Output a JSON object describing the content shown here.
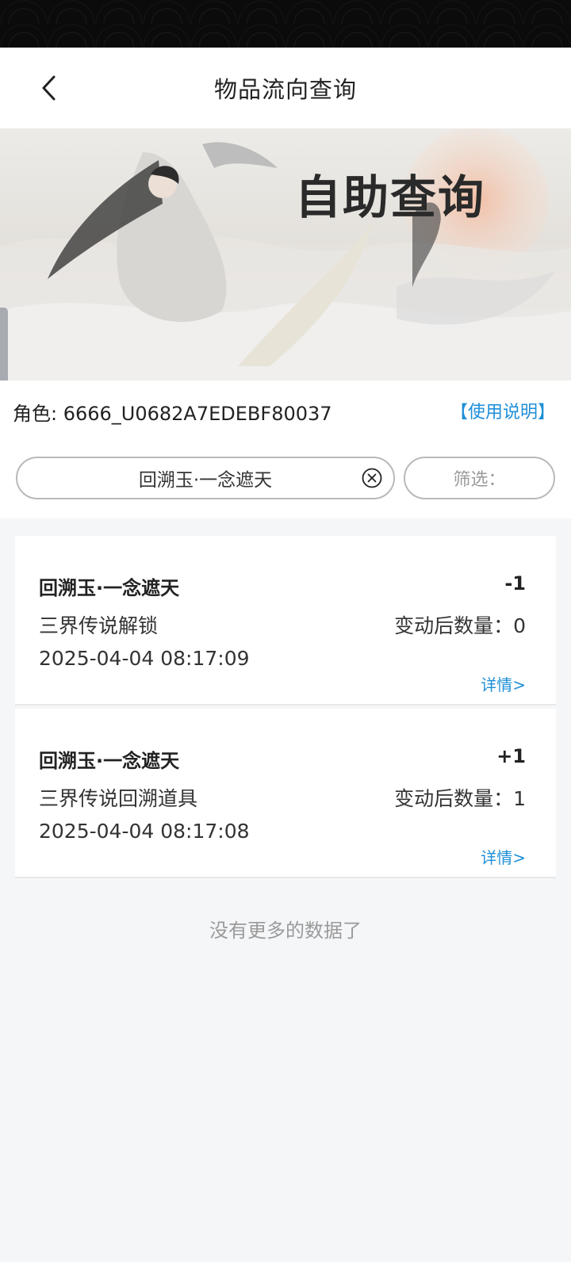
{
  "header": {
    "title": "物品流向查询"
  },
  "banner": {
    "title": "自助查询"
  },
  "info": {
    "role_text": "角色: 6666_U0682A7EDEBF80037",
    "help_link": "【使用说明】"
  },
  "search": {
    "value": "回溯玉·一念遮天",
    "filter_label": "筛选："
  },
  "records": [
    {
      "name": "回溯玉·一念遮天",
      "delta": "-1",
      "source": "三界传说解锁",
      "after_count": "变动后数量：0",
      "time": "2025-04-04 08:17:09",
      "detail": "详情>"
    },
    {
      "name": "回溯玉·一念遮天",
      "delta": "+1",
      "source": "三界传说回溯道具",
      "after_count": "变动后数量：1",
      "time": "2025-04-04 08:17:08",
      "detail": "详情>"
    }
  ],
  "footer": {
    "no_more": "没有更多的数据了"
  },
  "colors": {
    "accent": "#1f8fd8",
    "background": "#f5f6f8"
  }
}
